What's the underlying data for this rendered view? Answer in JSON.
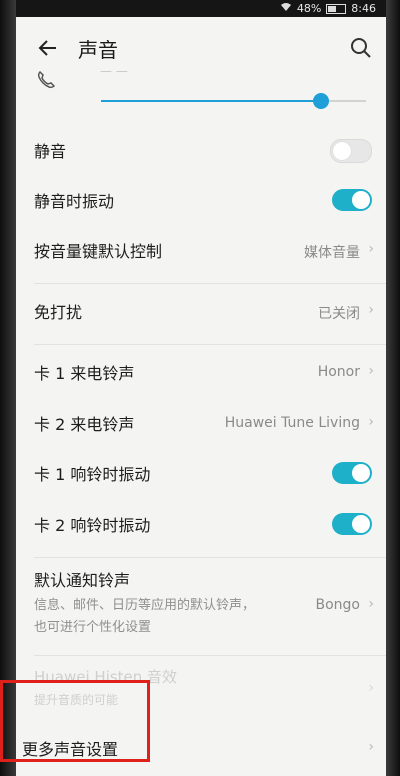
{
  "status_bar": {
    "carrier": "",
    "battery_text": "48%",
    "time": "8:46"
  },
  "header": {
    "title": "声音"
  },
  "volume": {
    "label": "— —",
    "level": 0.83
  },
  "settings": {
    "silent": {
      "label": "静音",
      "on": false
    },
    "vibrate_silent": {
      "label": "静音时振动",
      "on": true
    },
    "volume_key": {
      "label": "按音量键默认控制",
      "value": "媒体音量"
    },
    "dnd": {
      "label": "免打扰",
      "value": "已关闭"
    },
    "sim1_ringtone": {
      "label": "卡 1 来电铃声",
      "value": "Honor"
    },
    "sim2_ringtone": {
      "label": "卡 2 来电铃声",
      "value": "Huawei Tune Living"
    },
    "sim1_vibrate": {
      "label": "卡 1 响铃时振动",
      "on": true
    },
    "sim2_vibrate": {
      "label": "卡 2 响铃时振动",
      "on": true
    },
    "notification": {
      "label": "默认通知铃声",
      "desc_line1": "信息、邮件、日历等应用的默认铃声，",
      "desc_line2": "也可进行个性化设置",
      "value": "Bongo"
    },
    "histen": {
      "label": "Huawei Histen 音效",
      "sub": "提升音质的可能"
    },
    "more": {
      "label": "更多声音设置"
    }
  },
  "colors": {
    "accent": "#1fb0c9",
    "highlight": "#e0201a"
  }
}
